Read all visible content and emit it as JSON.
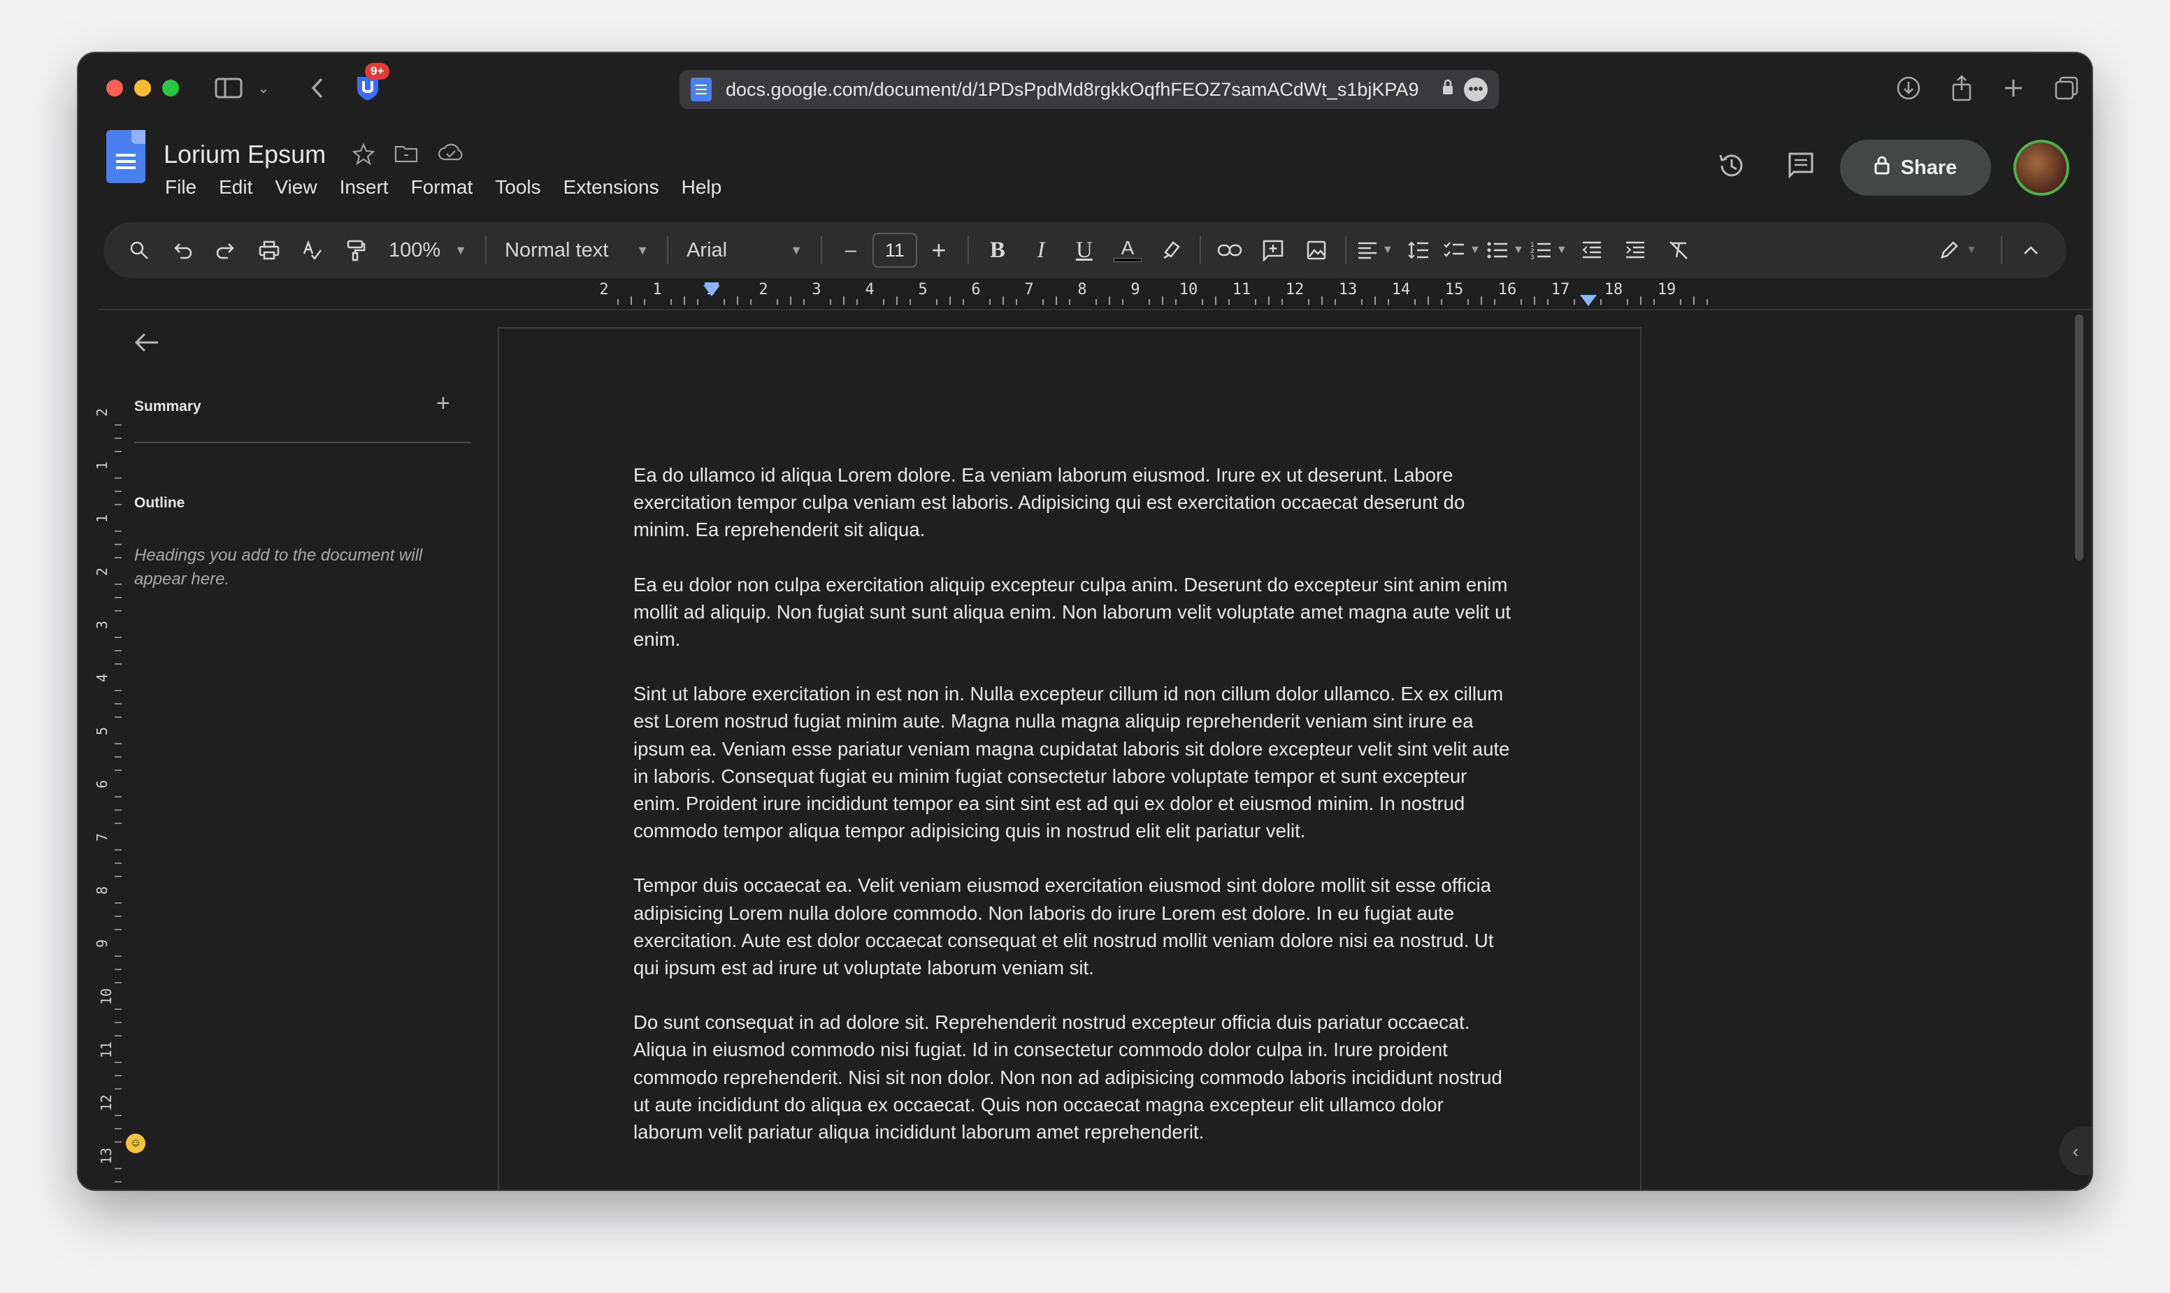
{
  "browser": {
    "url": "docs.google.com/document/d/1PDsPpdMd8rgkkOqfhFEOZ7samACdWt_s1bjKPA9",
    "extension_badge": "9+"
  },
  "doc": {
    "title": "Lorium Epsum",
    "menu": [
      "File",
      "Edit",
      "View",
      "Insert",
      "Format",
      "Tools",
      "Extensions",
      "Help"
    ],
    "share_label": "Share"
  },
  "toolbar": {
    "zoom": "100%",
    "style": "Normal text",
    "font": "Arial",
    "font_size": "11",
    "bold": "B",
    "italic": "I",
    "underline": "U",
    "text_color": "A"
  },
  "ruler": {
    "h_numbers": [
      "2",
      "1",
      "1",
      "2",
      "3",
      "4",
      "5",
      "6",
      "7",
      "8",
      "9",
      "10",
      "11",
      "12",
      "13",
      "14",
      "15",
      "16",
      "17",
      "18",
      "19"
    ],
    "v_numbers": [
      "2",
      "1",
      "1",
      "2",
      "3",
      "4",
      "5",
      "6",
      "7",
      "8",
      "9",
      "10",
      "11",
      "12",
      "13"
    ]
  },
  "sidebar": {
    "summary_label": "Summary",
    "outline_label": "Outline",
    "outline_hint": "Headings you add to the document will appear here."
  },
  "content": {
    "paragraphs": [
      "Ea do ullamco id aliqua Lorem dolore. Ea veniam laborum eiusmod. Irure ex ut deserunt. Labore exercitation tempor culpa veniam est laboris. Adipisicing qui est exercitation occaecat deserunt do minim. Ea reprehenderit sit aliqua.",
      "Ea eu dolor non culpa exercitation aliquip excepteur culpa anim. Deserunt do excepteur sint anim enim mollit ad aliquip. Non fugiat sunt sunt aliqua enim. Non laborum velit voluptate amet magna aute velit ut enim.",
      "Sint ut labore exercitation in est non in. Nulla excepteur cillum id non cillum dolor ullamco. Ex ex cillum est Lorem nostrud fugiat minim aute. Magna nulla magna aliquip reprehenderit veniam sint irure ea ipsum ea. Veniam esse pariatur veniam magna cupidatat laboris sit dolore excepteur velit sint velit aute in laboris. Consequat fugiat eu minim fugiat consectetur labore voluptate tempor et sunt excepteur enim. Proident irure incididunt tempor ea sint sint est ad qui ex dolor et eiusmod minim. In nostrud commodo tempor aliqua tempor adipisicing quis in nostrud elit elit pariatur velit.",
      "Tempor duis occaecat ea. Velit veniam eiusmod exercitation eiusmod sint dolore mollit sit esse officia adipisicing Lorem nulla dolore commodo. Non laboris do irure Lorem est dolore. In eu fugiat aute exercitation. Aute est dolor occaecat consequat et elit nostrud mollit veniam dolore nisi ea nostrud. Ut qui ipsum est ad irure ut voluptate laborum veniam sit.",
      "Do sunt consequat in ad dolore sit. Reprehenderit nostrud excepteur officia duis pariatur occaecat. Aliqua in eiusmod commodo nisi fugiat. Id in consectetur commodo dolor culpa in. Irure proident commodo reprehenderit. Nisi sit non dolor. Non non ad adipisicing commodo laboris incididunt nostrud ut aute incididunt do aliqua ex occaecat. Quis non occaecat magna excepteur elit ullamco dolor laborum velit pariatur aliqua incididunt laborum amet reprehenderit."
    ]
  },
  "icons": {
    "sidebar_toggle": "sidebar-toggle-icon",
    "back": "back-arrow-icon",
    "extension": "shield-extension-icon",
    "star": "star-icon",
    "folder": "move-folder-icon",
    "cloud": "cloud-status-icon",
    "history": "version-history-icon",
    "comment": "comment-icon",
    "lock": "lock-icon"
  },
  "colors": {
    "accent": "#4a7ff0",
    "background": "#1f1f1f",
    "toolbar": "#2d2d2d"
  }
}
